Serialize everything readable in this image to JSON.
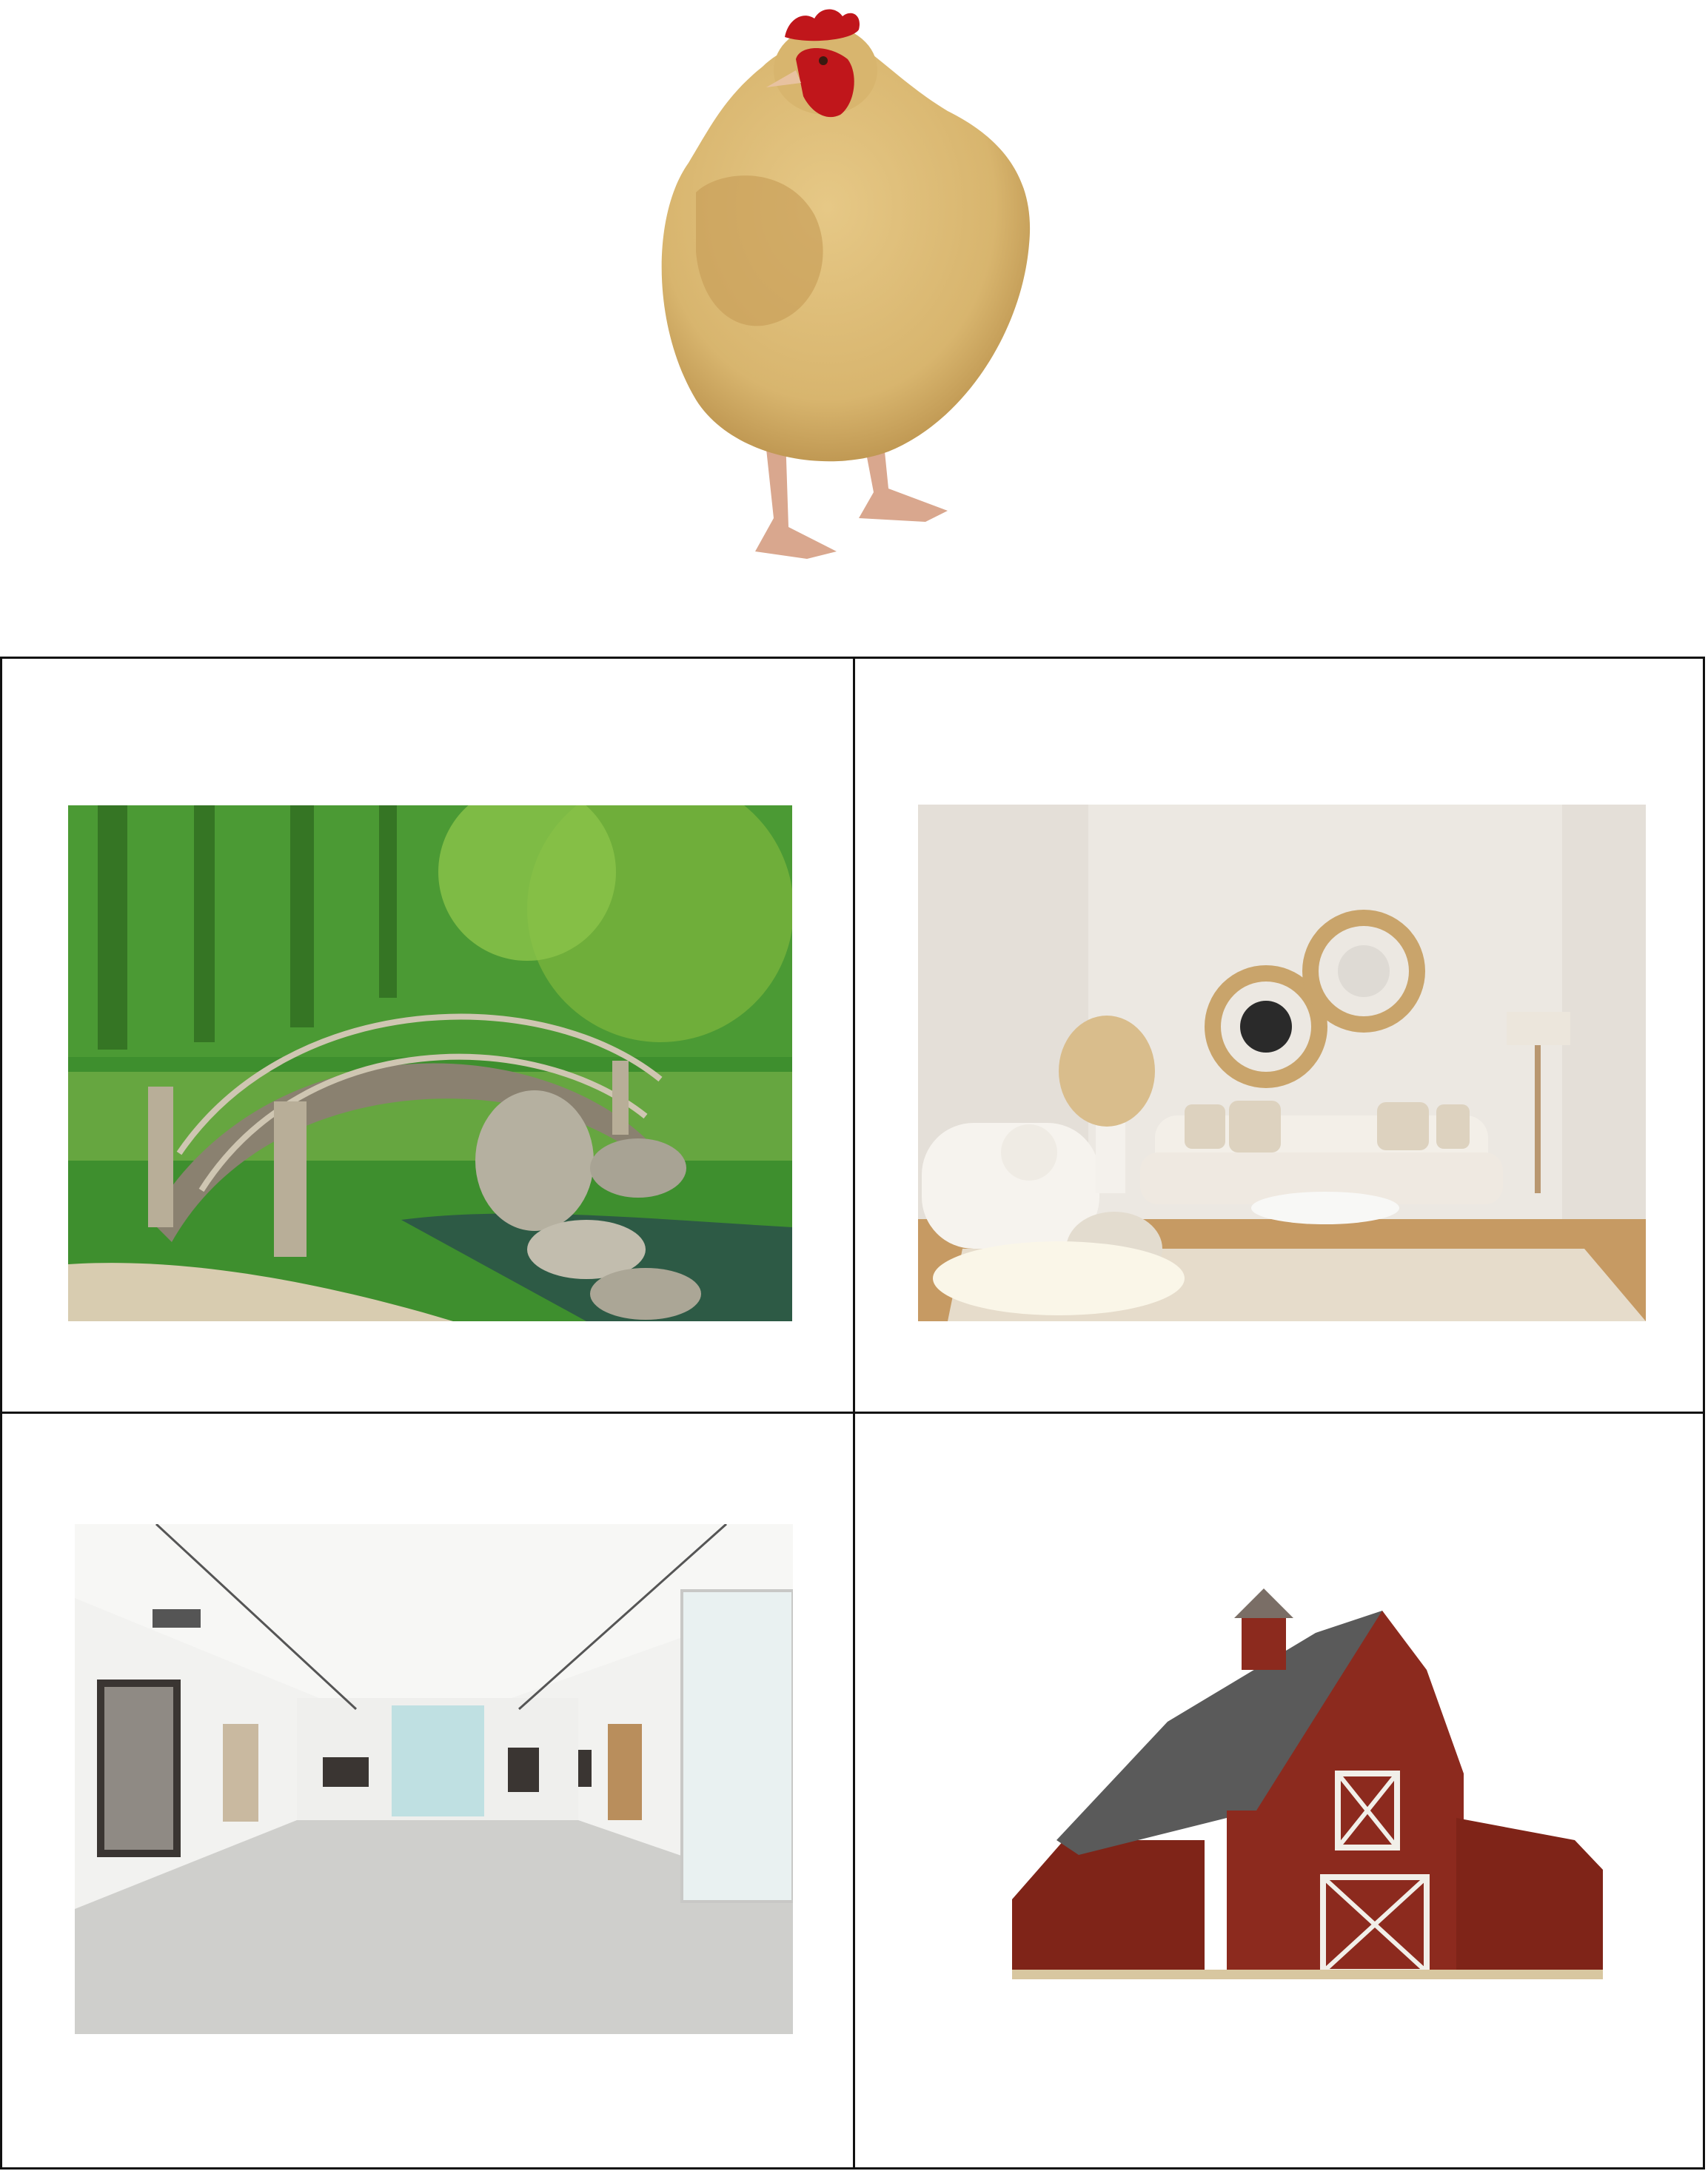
{
  "images": [
    {
      "name": "hen",
      "colors": {
        "body": "#d8b56e",
        "shade": "#b88f4a",
        "comb": "#c0161b",
        "legs": "#d9a78e"
      }
    },
    {
      "name": "garden-bridge",
      "colors": {
        "foliage": "#3e8f2e",
        "light": "#8bc34a",
        "water": "#2d5a45",
        "bridge": "#8a8170",
        "rock": "#b5b0a0"
      }
    },
    {
      "name": "living-room",
      "colors": {
        "wall": "#ece8e2",
        "sofa": "#f3efe8",
        "floor": "#c69a63",
        "rug": "#e6dccb",
        "mirror": "#c9a46b"
      }
    },
    {
      "name": "gallery-hall",
      "colors": {
        "wall": "#f2f2f0",
        "floor": "#cfcfcc",
        "window": "#bfe0e2",
        "frame": "#3a3532"
      }
    },
    {
      "name": "red-barn",
      "colors": {
        "wall": "#8c2a1e",
        "roof": "#5a5a5a",
        "trim": "#f1efe9",
        "base": "#d8c7a0"
      }
    }
  ]
}
